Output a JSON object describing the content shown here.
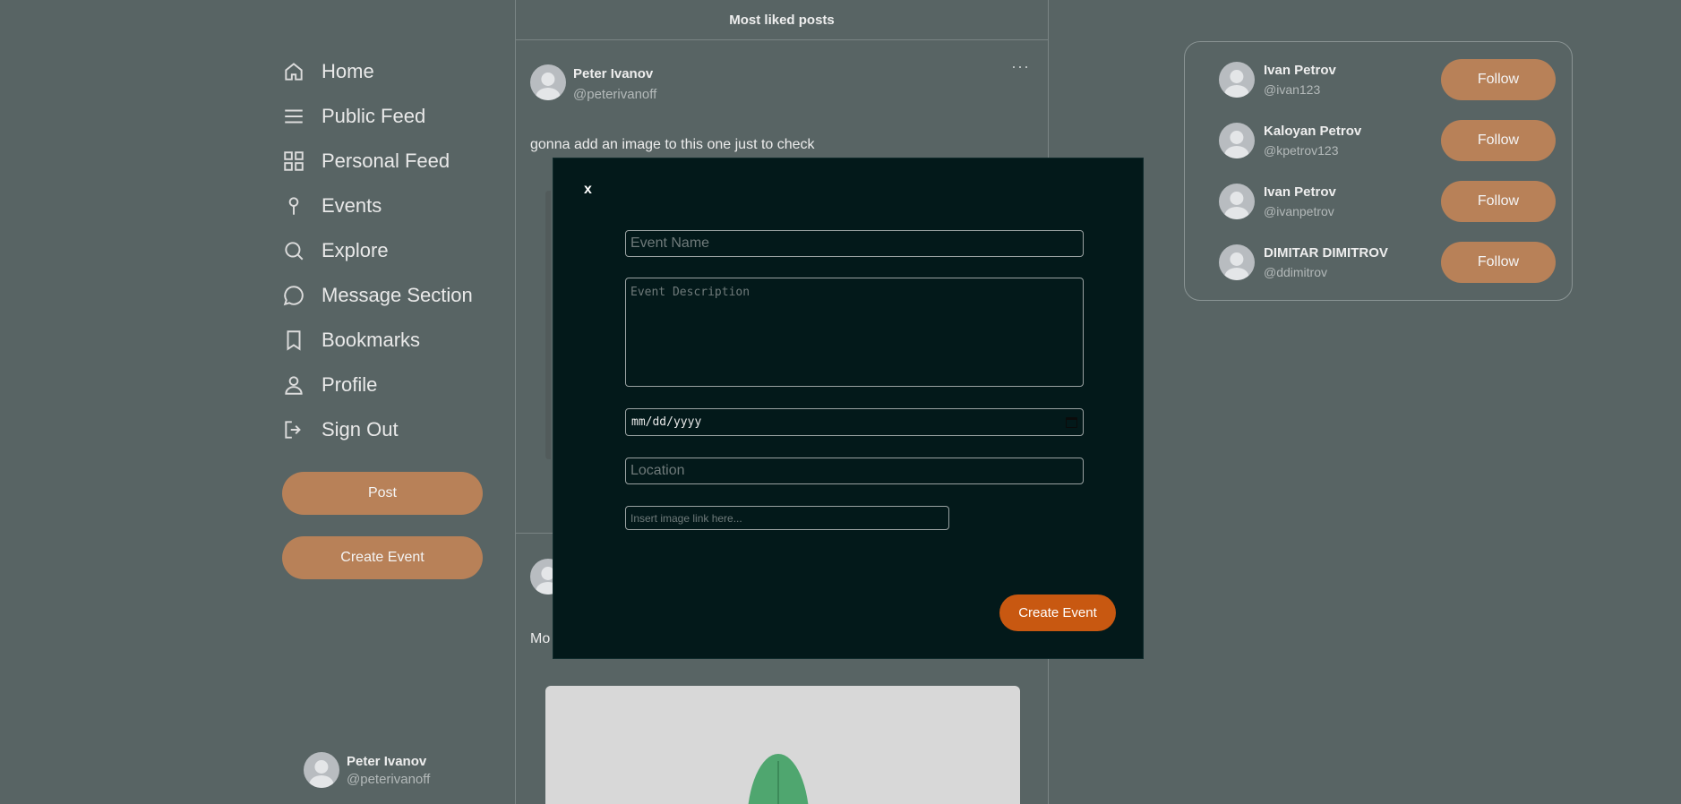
{
  "nav": {
    "items": [
      {
        "label": "Home",
        "icon": "home-icon"
      },
      {
        "label": "Public Feed",
        "icon": "menu-icon"
      },
      {
        "label": "Personal Feed",
        "icon": "grid-icon"
      },
      {
        "label": "Events",
        "icon": "pin-icon"
      },
      {
        "label": "Explore",
        "icon": "search-icon"
      },
      {
        "label": "Message Section",
        "icon": "message-icon"
      },
      {
        "label": "Bookmarks",
        "icon": "bookmark-icon"
      },
      {
        "label": "Profile",
        "icon": "user-icon"
      },
      {
        "label": "Sign Out",
        "icon": "sign-out-icon"
      }
    ],
    "post_button": "Post",
    "create_event_button": "Create Event"
  },
  "current_user": {
    "name": "Peter Ivanov",
    "handle": "@peterivanoff"
  },
  "feed": {
    "title": "Most liked posts",
    "posts": [
      {
        "author": "Peter Ivanov",
        "handle": "@peterivanoff",
        "more": "···",
        "text": "gonna add an image to this one just to check"
      },
      {
        "text": "Mo"
      }
    ]
  },
  "who_to_follow": [
    {
      "name": "Ivan Petrov",
      "handle": "@ivan123",
      "button": "Follow"
    },
    {
      "name": "Kaloyan Petrov",
      "handle": "@kpetrov123",
      "button": "Follow"
    },
    {
      "name": "Ivan Petrov",
      "handle": "@ivanpetrov",
      "button": "Follow"
    },
    {
      "name": "DIMITAR DIMITROV",
      "handle": "@ddimitrov",
      "button": "Follow"
    }
  ],
  "modal": {
    "close": "x",
    "event_name_placeholder": "Event Name",
    "event_description_placeholder": "Event Description",
    "date_placeholder": "mm/dd/yyyy",
    "location_placeholder": "Location",
    "image_link_placeholder": "Insert image link here...",
    "submit": "Create Event"
  },
  "colors": {
    "background": "#586464",
    "accent_button": "#b88158",
    "modal_background": "#03191a",
    "modal_submit": "#c85811"
  }
}
